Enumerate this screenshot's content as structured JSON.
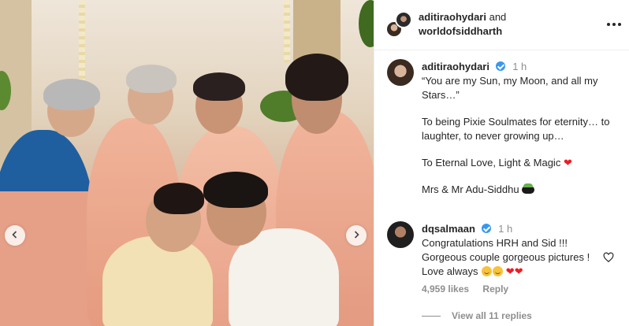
{
  "post_header": {
    "user1": "aditiraohydari",
    "and_text": "and",
    "user2": "worldofsiddharth"
  },
  "caption": {
    "username": "aditiraohydari",
    "time": "1 h",
    "lines": [
      "“You are my Sun, my Moon, and all my Stars…”",
      "To being Pixie Soulmates for eternity… to laughter, to never growing up…",
      "To Eternal Love, Light & Magic",
      "Mrs & Mr Adu-Siddhu"
    ]
  },
  "comment": {
    "username": "dqsalmaan",
    "time": "1 h",
    "text_line1": "Congratulations HRH and Sid !!!",
    "text_line2": "Gorgeous couple gorgeous pictures ! Love always",
    "likes": "4,959 likes",
    "reply": "Reply",
    "view_replies": "View all 11 replies"
  },
  "icons": {
    "more": "more-horizontal-icon",
    "prev": "chevron-left-icon",
    "next": "chevron-right-icon",
    "like": "heart-outline-icon"
  },
  "colors": {
    "verified": "#3897f0",
    "heart": "#ed1c24",
    "muted": "#8e8e8e"
  }
}
